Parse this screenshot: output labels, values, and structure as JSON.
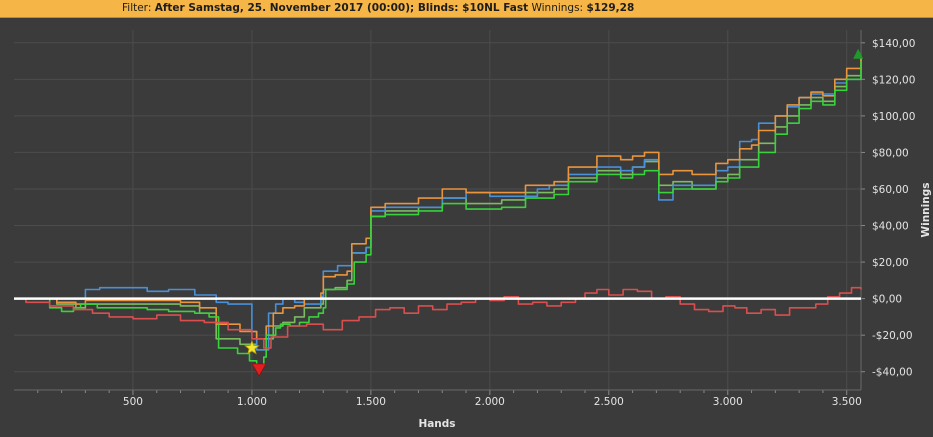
{
  "header": {
    "filter_label": "Filter:",
    "filter_value": "After Samstag, 25. November 2017 (00:00); Blinds: $10NL Fast",
    "winnings_label": "Winnings:",
    "winnings_value": "$129,28"
  },
  "colors": {
    "background": "#3b3b3b",
    "grid": "#4c4c4c",
    "header_bg": "#f5b547",
    "zero_line": "#ffffff"
  },
  "chart_data": {
    "type": "line",
    "xlabel": "Hands",
    "ylabel": "Winnings",
    "xlim": [
      0,
      3560
    ],
    "ylim": [
      -50,
      147
    ],
    "x_ticks": [
      {
        "value": 500,
        "label": "500"
      },
      {
        "value": 1000,
        "label": "1.000"
      },
      {
        "value": 1500,
        "label": "1.500"
      },
      {
        "value": 2000,
        "label": "2.000"
      },
      {
        "value": 2500,
        "label": "2.500"
      },
      {
        "value": 3000,
        "label": "3.000"
      },
      {
        "value": 3500,
        "label": "3.500"
      }
    ],
    "y_ticks": [
      {
        "value": 140,
        "label": "$140,00"
      },
      {
        "value": 120,
        "label": "$120,00"
      },
      {
        "value": 100,
        "label": "$100,00"
      },
      {
        "value": 80,
        "label": "$80,00"
      },
      {
        "value": 60,
        "label": "$60,00"
      },
      {
        "value": 40,
        "label": "$40,00"
      },
      {
        "value": 20,
        "label": "$20,00"
      },
      {
        "value": 0,
        "label": "$0,00"
      },
      {
        "value": -20,
        "label": "-$20,00"
      },
      {
        "value": -40,
        "label": "-$40,00"
      }
    ],
    "series": [
      {
        "color": "#7dbb63",
        "values": [
          [
            0,
            0
          ],
          [
            150,
            0
          ],
          [
            180,
            -3
          ],
          [
            260,
            -5
          ],
          [
            300,
            -3
          ],
          [
            700,
            -4
          ],
          [
            780,
            -8
          ],
          [
            850,
            -22
          ],
          [
            950,
            -25
          ],
          [
            1020,
            -28
          ],
          [
            1060,
            -22
          ],
          [
            1090,
            -15
          ],
          [
            1130,
            -13
          ],
          [
            1180,
            -10
          ],
          [
            1220,
            -5
          ],
          [
            1290,
            -3
          ],
          [
            1300,
            5
          ],
          [
            1350,
            6
          ],
          [
            1400,
            10
          ],
          [
            1420,
            25
          ],
          [
            1480,
            28
          ],
          [
            1500,
            45
          ],
          [
            1560,
            48
          ],
          [
            1700,
            50
          ],
          [
            1800,
            55
          ],
          [
            1900,
            52
          ],
          [
            2050,
            54
          ],
          [
            2150,
            58
          ],
          [
            2270,
            60
          ],
          [
            2330,
            66
          ],
          [
            2450,
            70
          ],
          [
            2550,
            68
          ],
          [
            2600,
            72
          ],
          [
            2650,
            75
          ],
          [
            2710,
            62
          ],
          [
            2770,
            64
          ],
          [
            2850,
            60
          ],
          [
            2950,
            66
          ],
          [
            3000,
            68
          ],
          [
            3050,
            76
          ],
          [
            3100,
            76
          ],
          [
            3130,
            85
          ],
          [
            3200,
            94
          ],
          [
            3250,
            100
          ],
          [
            3300,
            106
          ],
          [
            3350,
            110
          ],
          [
            3400,
            108
          ],
          [
            3450,
            116
          ],
          [
            3500,
            122
          ],
          [
            3560,
            133
          ]
        ]
      },
      {
        "color": "#4a90d9",
        "values": [
          [
            0,
            0
          ],
          [
            100,
            0
          ],
          [
            300,
            5
          ],
          [
            360,
            6
          ],
          [
            560,
            4
          ],
          [
            650,
            5
          ],
          [
            760,
            2
          ],
          [
            850,
            -2
          ],
          [
            900,
            -3
          ],
          [
            1000,
            -18
          ],
          [
            1020,
            -28
          ],
          [
            1070,
            -8
          ],
          [
            1100,
            -3
          ],
          [
            1130,
            0
          ],
          [
            1180,
            -2
          ],
          [
            1220,
            -3
          ],
          [
            1290,
            1
          ],
          [
            1300,
            15
          ],
          [
            1360,
            18
          ],
          [
            1420,
            25
          ],
          [
            1480,
            28
          ],
          [
            1500,
            48
          ],
          [
            1560,
            50
          ],
          [
            1700,
            50
          ],
          [
            1800,
            55
          ],
          [
            1900,
            58
          ],
          [
            2000,
            56
          ],
          [
            2100,
            56
          ],
          [
            2200,
            60
          ],
          [
            2250,
            62
          ],
          [
            2330,
            68
          ],
          [
            2450,
            72
          ],
          [
            2550,
            70
          ],
          [
            2600,
            72
          ],
          [
            2650,
            76
          ],
          [
            2710,
            54
          ],
          [
            2750,
            54
          ],
          [
            2770,
            62
          ],
          [
            2850,
            62
          ],
          [
            2950,
            70
          ],
          [
            3000,
            72
          ],
          [
            3050,
            86
          ],
          [
            3100,
            87
          ],
          [
            3130,
            96
          ],
          [
            3200,
            100
          ],
          [
            3250,
            105
          ],
          [
            3300,
            110
          ],
          [
            3350,
            112
          ],
          [
            3400,
            112
          ],
          [
            3450,
            118
          ],
          [
            3500,
            120
          ],
          [
            3560,
            122
          ]
        ]
      },
      {
        "color": "#e8953e",
        "values": [
          [
            0,
            0
          ],
          [
            150,
            0
          ],
          [
            180,
            -2
          ],
          [
            260,
            -3
          ],
          [
            300,
            -1
          ],
          [
            700,
            -2
          ],
          [
            780,
            -5
          ],
          [
            850,
            -14
          ],
          [
            950,
            -18
          ],
          [
            1020,
            -22
          ],
          [
            1060,
            -15
          ],
          [
            1090,
            -8
          ],
          [
            1130,
            -5
          ],
          [
            1180,
            -4
          ],
          [
            1220,
            0
          ],
          [
            1290,
            3
          ],
          [
            1300,
            12
          ],
          [
            1350,
            13
          ],
          [
            1400,
            15
          ],
          [
            1420,
            30
          ],
          [
            1480,
            33
          ],
          [
            1500,
            50
          ],
          [
            1560,
            52
          ],
          [
            1700,
            55
          ],
          [
            1800,
            60
          ],
          [
            1900,
            58
          ],
          [
            2050,
            58
          ],
          [
            2150,
            62
          ],
          [
            2270,
            64
          ],
          [
            2330,
            72
          ],
          [
            2450,
            78
          ],
          [
            2550,
            76
          ],
          [
            2600,
            78
          ],
          [
            2650,
            80
          ],
          [
            2710,
            68
          ],
          [
            2770,
            70
          ],
          [
            2850,
            68
          ],
          [
            2950,
            74
          ],
          [
            3000,
            76
          ],
          [
            3050,
            82
          ],
          [
            3100,
            84
          ],
          [
            3130,
            92
          ],
          [
            3200,
            100
          ],
          [
            3250,
            106
          ],
          [
            3300,
            110
          ],
          [
            3350,
            113
          ],
          [
            3400,
            111
          ],
          [
            3450,
            120
          ],
          [
            3500,
            126
          ],
          [
            3560,
            132
          ]
        ]
      },
      {
        "color": "#38d23a",
        "values": [
          [
            0,
            0
          ],
          [
            100,
            0
          ],
          [
            150,
            -5
          ],
          [
            200,
            -7
          ],
          [
            250,
            -5
          ],
          [
            280,
            -3
          ],
          [
            350,
            -5
          ],
          [
            560,
            -6
          ],
          [
            650,
            -7
          ],
          [
            760,
            -8
          ],
          [
            820,
            -10
          ],
          [
            860,
            -27
          ],
          [
            940,
            -30
          ],
          [
            990,
            -34
          ],
          [
            1020,
            -36
          ],
          [
            1050,
            -32
          ],
          [
            1060,
            -20
          ],
          [
            1100,
            -16
          ],
          [
            1120,
            -14
          ],
          [
            1160,
            -15
          ],
          [
            1200,
            -13
          ],
          [
            1240,
            -10
          ],
          [
            1280,
            -8
          ],
          [
            1300,
            -5
          ],
          [
            1310,
            5
          ],
          [
            1400,
            8
          ],
          [
            1430,
            20
          ],
          [
            1480,
            24
          ],
          [
            1500,
            45
          ],
          [
            1560,
            46
          ],
          [
            1700,
            48
          ],
          [
            1800,
            52
          ],
          [
            1900,
            49
          ],
          [
            2050,
            50
          ],
          [
            2150,
            55
          ],
          [
            2270,
            57
          ],
          [
            2330,
            64
          ],
          [
            2450,
            68
          ],
          [
            2550,
            66
          ],
          [
            2600,
            68
          ],
          [
            2650,
            70
          ],
          [
            2710,
            58
          ],
          [
            2770,
            60
          ],
          [
            2850,
            60
          ],
          [
            2950,
            64
          ],
          [
            3000,
            66
          ],
          [
            3050,
            72
          ],
          [
            3100,
            72
          ],
          [
            3130,
            80
          ],
          [
            3200,
            90
          ],
          [
            3250,
            96
          ],
          [
            3300,
            104
          ],
          [
            3350,
            108
          ],
          [
            3400,
            106
          ],
          [
            3450,
            114
          ],
          [
            3500,
            120
          ],
          [
            3560,
            130
          ]
        ]
      },
      {
        "color": "#d94f4f",
        "values": [
          [
            0,
            0
          ],
          [
            50,
            -2
          ],
          [
            150,
            -4
          ],
          [
            250,
            -6
          ],
          [
            330,
            -8
          ],
          [
            400,
            -10
          ],
          [
            500,
            -11
          ],
          [
            600,
            -9
          ],
          [
            700,
            -12
          ],
          [
            800,
            -13
          ],
          [
            900,
            -17
          ],
          [
            1000,
            -22
          ],
          [
            1050,
            -27
          ],
          [
            1080,
            -21
          ],
          [
            1150,
            -15
          ],
          [
            1230,
            -14
          ],
          [
            1300,
            -17
          ],
          [
            1380,
            -12
          ],
          [
            1450,
            -10
          ],
          [
            1520,
            -6
          ],
          [
            1580,
            -5
          ],
          [
            1640,
            -8
          ],
          [
            1700,
            -4
          ],
          [
            1760,
            -6
          ],
          [
            1820,
            -3
          ],
          [
            1880,
            -2
          ],
          [
            1940,
            0
          ],
          [
            2000,
            -1
          ],
          [
            2060,
            1
          ],
          [
            2120,
            -3
          ],
          [
            2180,
            -2
          ],
          [
            2240,
            -4
          ],
          [
            2300,
            -2
          ],
          [
            2360,
            0
          ],
          [
            2400,
            3
          ],
          [
            2450,
            5
          ],
          [
            2500,
            2
          ],
          [
            2560,
            5
          ],
          [
            2620,
            4
          ],
          [
            2680,
            0
          ],
          [
            2740,
            1
          ],
          [
            2800,
            -3
          ],
          [
            2860,
            -6
          ],
          [
            2920,
            -7
          ],
          [
            2980,
            -4
          ],
          [
            3030,
            -5
          ],
          [
            3080,
            -8
          ],
          [
            3140,
            -6
          ],
          [
            3200,
            -9
          ],
          [
            3260,
            -5
          ],
          [
            3310,
            -5
          ],
          [
            3370,
            -3
          ],
          [
            3420,
            1
          ],
          [
            3470,
            3
          ],
          [
            3520,
            6
          ],
          [
            3560,
            5
          ]
        ]
      }
    ],
    "markers": [
      {
        "type": "star",
        "x": 1000,
        "y": -27,
        "color": "#f5e530"
      },
      {
        "type": "triangle-down",
        "x": 1030,
        "y": -39,
        "color": "#e02020"
      },
      {
        "type": "triangle-up",
        "x": 3548,
        "y": 134,
        "color": "#1e9a2a"
      }
    ]
  }
}
